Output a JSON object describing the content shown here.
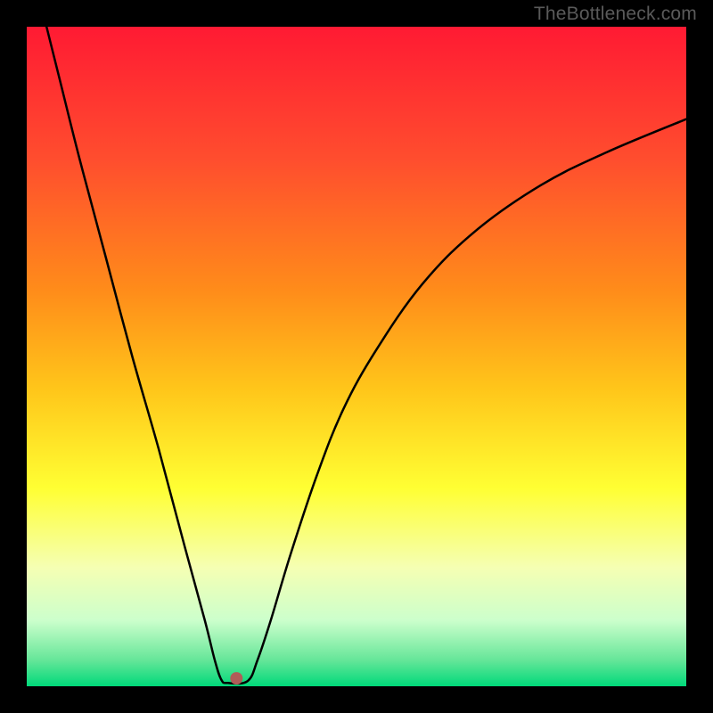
{
  "watermark": "TheBottleneck.com",
  "chart_data": {
    "type": "line",
    "title": "",
    "xlabel": "",
    "ylabel": "",
    "xlim": [
      0,
      100
    ],
    "ylim": [
      0,
      100
    ],
    "grid": false,
    "legend": false,
    "background_gradient_stops": [
      {
        "offset": 0.0,
        "color": "#ff1a33"
      },
      {
        "offset": 0.2,
        "color": "#ff4d2e"
      },
      {
        "offset": 0.4,
        "color": "#ff8c1a"
      },
      {
        "offset": 0.55,
        "color": "#ffc61a"
      },
      {
        "offset": 0.7,
        "color": "#ffff33"
      },
      {
        "offset": 0.82,
        "color": "#f5ffb3"
      },
      {
        "offset": 0.9,
        "color": "#ccffcc"
      },
      {
        "offset": 0.96,
        "color": "#66e699"
      },
      {
        "offset": 1.0,
        "color": "#00d97a"
      }
    ],
    "series": [
      {
        "name": "curve",
        "color": "#000000",
        "x": [
          3,
          5,
          8,
          12,
          16,
          20,
          24,
          27,
          28.5,
          29.5,
          30.5,
          33.5,
          35,
          37,
          40,
          44,
          48,
          53,
          60,
          68,
          78,
          88,
          100
        ],
        "y": [
          100,
          92,
          80,
          65,
          50,
          36,
          21,
          10,
          4,
          1,
          0.5,
          0.8,
          4,
          10,
          20,
          32,
          42,
          51,
          61,
          69,
          76,
          81,
          86
        ]
      }
    ],
    "marker": {
      "x": 31.8,
      "y": 1.2,
      "color": "#b05c58",
      "radius_px": 7
    },
    "plateau_note": "flat segment between x≈29.5 and x≈33.5 at y≈0.7"
  }
}
